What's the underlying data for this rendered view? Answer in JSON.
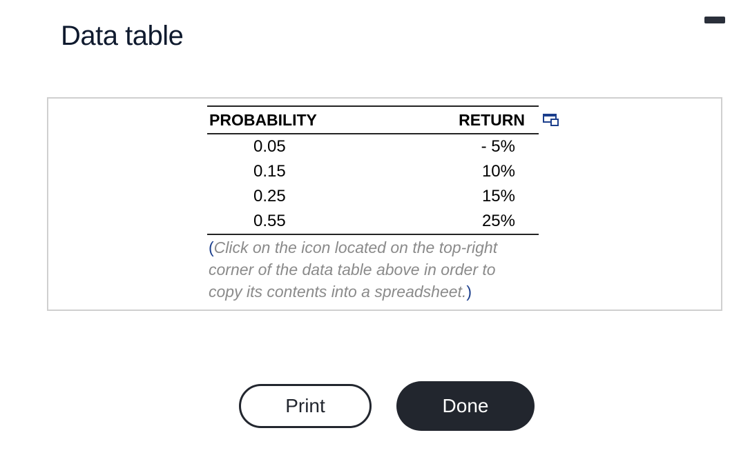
{
  "dialog": {
    "title": "Data table"
  },
  "table": {
    "headers": [
      "PROBABILITY",
      "RETURN"
    ],
    "rows": [
      [
        "0.05",
        "- 5%"
      ],
      [
        "0.15",
        "10%"
      ],
      [
        "0.25",
        "15%"
      ],
      [
        "0.55",
        "25%"
      ]
    ],
    "copy_icon": "copy-to-spreadsheet-icon"
  },
  "note": {
    "open_paren": "(",
    "text_line1": "Click on the icon located on the top-right",
    "text_line2": "corner of the data table above in order to",
    "text_line3": "copy its contents into a spreadsheet.",
    "close_paren": ")"
  },
  "buttons": {
    "print_label": "Print",
    "done_label": "Done"
  },
  "colors": {
    "button_dark": "#22262e",
    "note_text": "#8a8a8a",
    "paren": "#1b3e8c"
  }
}
